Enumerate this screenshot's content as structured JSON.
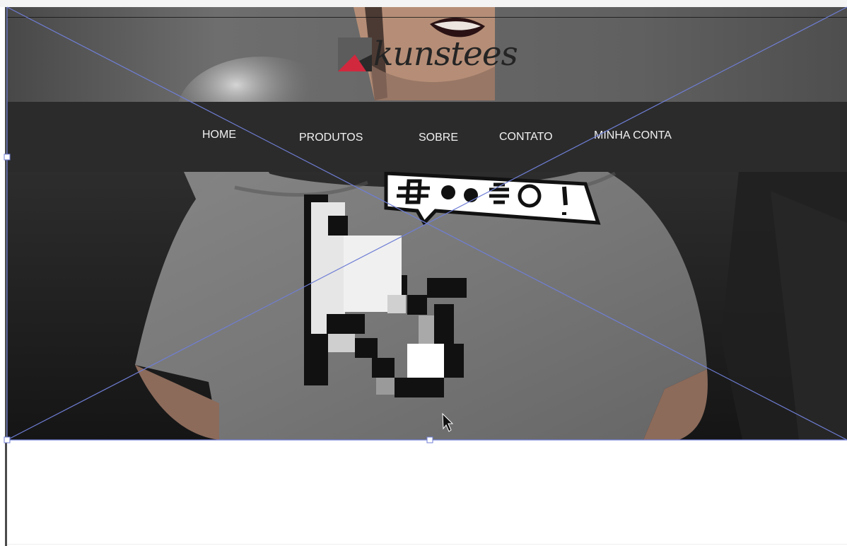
{
  "site": {
    "brand": "kunstees",
    "nav": [
      "HOME",
      "PRODUTOS",
      "SOBRE",
      "CONTATO",
      "MINHA CONTA"
    ],
    "shirt_print": "#%$@!",
    "logo_colors": {
      "light": "#5c5c5c",
      "dark": "#2a2a2a",
      "accent": "#d1283e"
    }
  },
  "editor": {
    "image_frame": "selected",
    "guide_color": "#6f7ed5"
  },
  "icons": {
    "logo": "kunstees-logo-mark",
    "cursor": "mouse-pointer-icon"
  }
}
